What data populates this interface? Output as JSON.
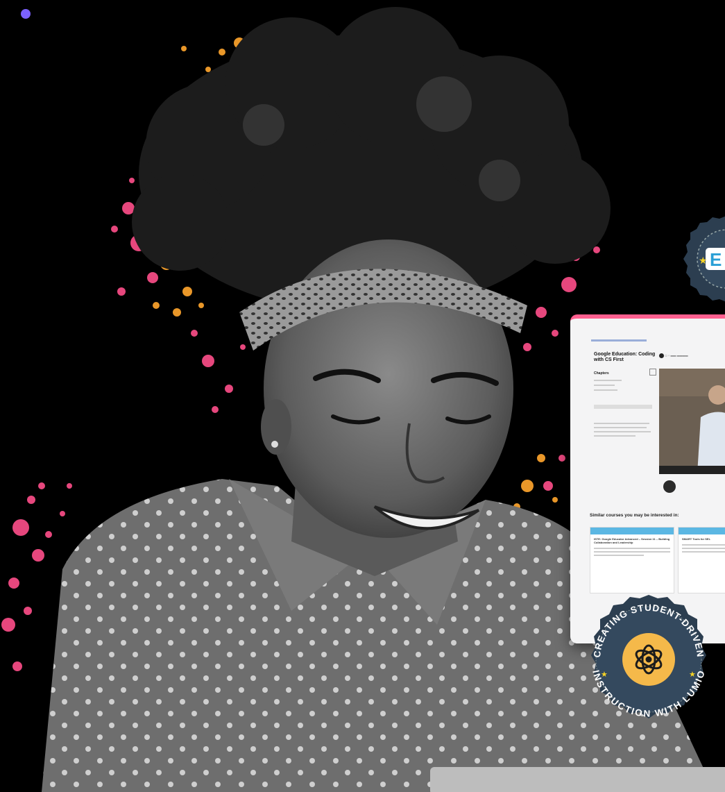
{
  "photo": {
    "subject": "Smiling woman with natural curly hair and a leopard-print headband, wearing a polka-dot shirt, looking down at a laptop"
  },
  "colors": {
    "background": "#000000",
    "accent_dot": "#7b61ff",
    "splatter_pink": "#ff4f8b",
    "splatter_orange": "#f6a02c",
    "badge_blue": "#2c3e50",
    "badge_gold": "#f5b94a",
    "card_stripe": "#ff5f8f"
  },
  "course_card": {
    "title": "Google Education: Coding with CS First",
    "chapters_label": "Chapters",
    "similar_label": "Similar courses you may be interested in:",
    "similar_courses": [
      {
        "title": "ISTE: Google Educator Advanced – Session 11 – Building Collaboration and Leadership"
      },
      {
        "title": "SMART Tools for SEL"
      }
    ]
  },
  "badges": {
    "main": {
      "text_top": "CREATING STUDENT-DRIVEN",
      "text_bottom": "INSTRUCTION WITH LUMIO",
      "icon": "lumio-atom-icon"
    },
    "partial": {
      "letter": "E",
      "icon": "star-icon"
    }
  }
}
